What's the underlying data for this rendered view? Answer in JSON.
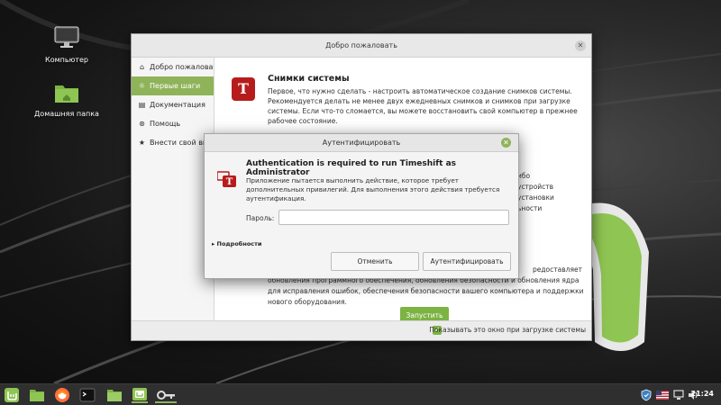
{
  "desktop": {
    "icons": [
      {
        "label": "Компьютер",
        "icon": "computer-icon"
      },
      {
        "label": "Домашняя папка",
        "icon": "home-folder-icon"
      }
    ]
  },
  "welcome": {
    "title": "Добро пожаловать",
    "sidebar": [
      {
        "label": "Добро пожаловать",
        "icon": "home-icon",
        "active": false
      },
      {
        "label": "Первые шаги",
        "icon": "lightbulb-icon",
        "active": true
      },
      {
        "label": "Документация",
        "icon": "document-icon",
        "active": false
      },
      {
        "label": "Помощь",
        "icon": "help-icon",
        "active": false
      },
      {
        "label": "Внести свой вклад",
        "icon": "star-icon",
        "active": false
      }
    ],
    "snapshot": {
      "title": "Снимки системы",
      "text": "Первое, что нужно сделать - настроить автоматическое создание снимков системы. Рекомендуется делать не менее двух ежедневных снимков и снимков при загрузке системы. Если что-то сломается, вы можете восстановить свой компьютер в прежнее рабочее состояние."
    },
    "partial_right_lines": [
      "ибо",
      "устройств",
      "установки",
      "ьности"
    ],
    "update": {
      "line0": "редоставляет",
      "line1": "обновления программного обеспечения, обновления безопасности и обновления ядра",
      "line2": "для исправления ошибок, обеспечения безопасности вашего компьютера и поддержки",
      "line3": "нового оборудования."
    },
    "launch_label": "Запустить",
    "footer_checkbox_label": "Показывать это окно при загрузке системы"
  },
  "auth": {
    "title": "Аутентифицировать",
    "heading": "Authentication is required to run Timeshift as Administrator",
    "description": "Приложение пытается выполнить действие, которое требует дополнительных привилегий. Для выполнения этого действия требуется аутентификация.",
    "password_label": "Пароль:",
    "password_value": "",
    "details_label": "Подробности",
    "cancel_label": "Отменить",
    "authenticate_label": "Аутентифицировать"
  },
  "taskbar": {
    "items": [
      "mint-menu-icon",
      "file-manager-icon",
      "firefox-icon",
      "terminal-icon",
      "folder-icon",
      "mint-welcome-icon",
      "auth-key-icon"
    ],
    "clock": "21:24"
  },
  "colors": {
    "accent": "#8fb359",
    "timeshift": "#b71c1c",
    "taskbar": "#2f2f2f"
  }
}
